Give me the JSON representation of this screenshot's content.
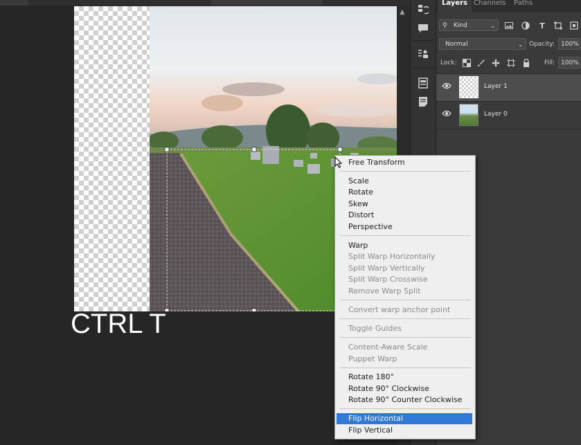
{
  "caption": "CTRL T",
  "layers_panel": {
    "tabs": [
      "Layers",
      "Channels",
      "Paths"
    ],
    "filter_kind": "Kind",
    "blend_mode": "Normal",
    "opacity_label": "Opacity:",
    "opacity_value": "100%",
    "lock_label": "Lock:",
    "fill_label": "Fill:",
    "fill_value": "100%",
    "layers": [
      {
        "name": "Layer 1",
        "selected": true
      },
      {
        "name": "Layer 0",
        "selected": false
      }
    ]
  },
  "context_menu": {
    "items": [
      {
        "label": "Free Transform",
        "enabled": true
      },
      {
        "label": "Scale",
        "enabled": true
      },
      {
        "label": "Rotate",
        "enabled": true
      },
      {
        "label": "Skew",
        "enabled": true
      },
      {
        "label": "Distort",
        "enabled": true
      },
      {
        "label": "Perspective",
        "enabled": true
      },
      {
        "label": "Warp",
        "enabled": true
      },
      {
        "label": "Split Warp Horizontally",
        "enabled": false
      },
      {
        "label": "Split Warp Vertically",
        "enabled": false
      },
      {
        "label": "Split Warp Crosswise",
        "enabled": false
      },
      {
        "label": "Remove Warp Split",
        "enabled": false
      },
      {
        "label": "Convert warp anchor point",
        "enabled": false
      },
      {
        "label": "Toggle Guides",
        "enabled": false
      },
      {
        "label": "Content-Aware Scale",
        "enabled": false
      },
      {
        "label": "Puppet Warp",
        "enabled": false
      },
      {
        "label": "Rotate 180°",
        "enabled": true
      },
      {
        "label": "Rotate 90° Clockwise",
        "enabled": true
      },
      {
        "label": "Rotate 90° Counter Clockwise",
        "enabled": true
      },
      {
        "label": "Flip Horizontal",
        "enabled": true,
        "highlighted": true
      },
      {
        "label": "Flip Vertical",
        "enabled": true
      }
    ]
  },
  "icons": {
    "tool_strip": [
      "history-icon",
      "comment-icon",
      "clone-source-icon",
      "properties-icon",
      "notes-icon"
    ],
    "layer_visibility": "eye-icon"
  }
}
